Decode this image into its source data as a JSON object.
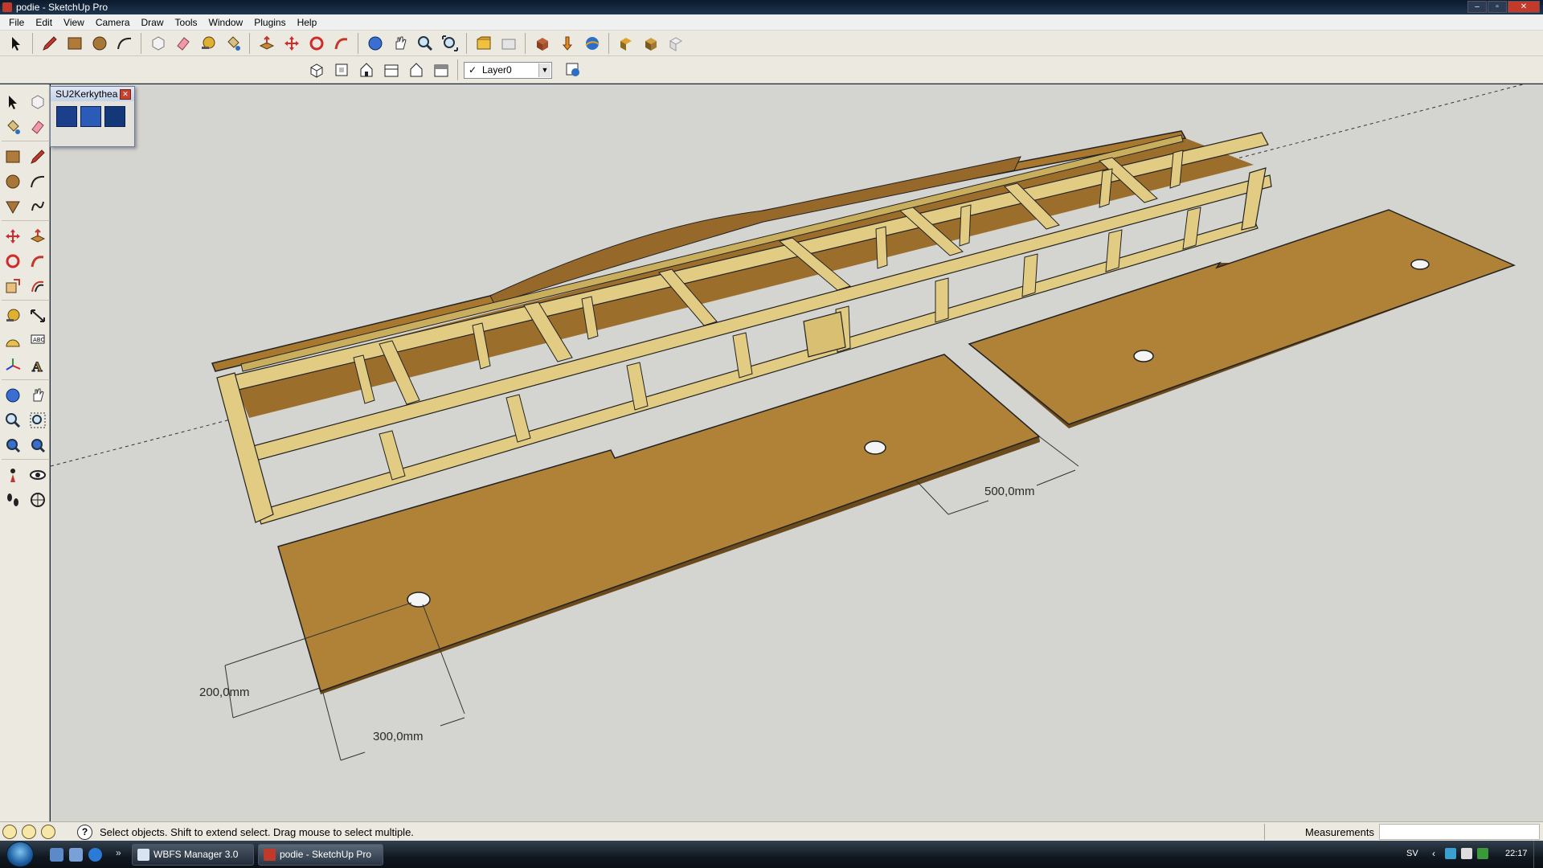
{
  "window": {
    "title": "podie - SketchUp Pro",
    "controls": [
      "minimize",
      "maximize",
      "close"
    ]
  },
  "menu": [
    "File",
    "Edit",
    "View",
    "Camera",
    "Draw",
    "Tools",
    "Window",
    "Plugins",
    "Help"
  ],
  "toolbar": {
    "main_tools": [
      "select-icon",
      "pencil-icon",
      "rectangle-icon",
      "circle-icon",
      "arc-icon",
      "make-component-icon",
      "eraser-icon",
      "tape-measure-icon",
      "paint-bucket-icon",
      "push-pull-icon",
      "move-icon",
      "rotate-icon",
      "follow-me-icon",
      "orbit-icon",
      "pan-icon",
      "zoom-icon",
      "zoom-extents-icon",
      "previous-view-icon",
      "next-view-icon",
      "get-models-icon",
      "share-model-icon",
      "google-earth-icon",
      "add-location-icon",
      "get-photo-icon",
      "toggle-terrain-icon"
    ],
    "view_tools": [
      "iso-view-icon",
      "top-view-icon",
      "front-view-icon",
      "right-view-icon",
      "back-view-icon",
      "left-view-icon"
    ],
    "layer": {
      "current": "Layer0",
      "visible_check": "✓"
    }
  },
  "kerkythea_toolbar": {
    "title": "SU2Kerkythea",
    "icons": [
      "export-model-icon",
      "render-settings-icon",
      "animation-icon"
    ]
  },
  "palette_tools": [
    "select-icon",
    "make-component-icon",
    "paint-bucket-icon",
    "eraser-icon",
    "rectangle-icon",
    "line-icon",
    "circle-icon",
    "arc-icon",
    "polygon-icon",
    "freehand-icon",
    "move-icon",
    "push-pull-icon",
    "rotate-icon",
    "follow-me-icon",
    "scale-icon",
    "offset-icon",
    "tape-measure-icon",
    "dimension-icon",
    "protractor-icon",
    "text-icon",
    "axes-icon",
    "3d-text-icon",
    "orbit-icon",
    "pan-icon",
    "zoom-icon",
    "zoom-window-icon",
    "zoom-extents-icon",
    "previous-icon",
    "position-camera-icon",
    "look-around-icon",
    "walk-icon",
    "section-plane-icon"
  ],
  "dimensions": {
    "gap": "500,0mm",
    "hole_offset_y": "200,0mm",
    "hole_offset_x": "300,0mm"
  },
  "status": {
    "message": "Select objects. Shift to extend select. Drag mouse to select multiple.",
    "measurements_label": "Measurements",
    "measurements_value": ""
  },
  "taskbar": {
    "tasks": [
      "WBFS Manager 3.0",
      "podie - SketchUp Pro"
    ],
    "language": "SV",
    "clock": "22:17",
    "more": "»"
  },
  "colors": {
    "board": "#b08238",
    "frame": "#e2cc84",
    "frame_shade": "#c9ae5e",
    "viewport_bg": "#d4d4d0"
  }
}
